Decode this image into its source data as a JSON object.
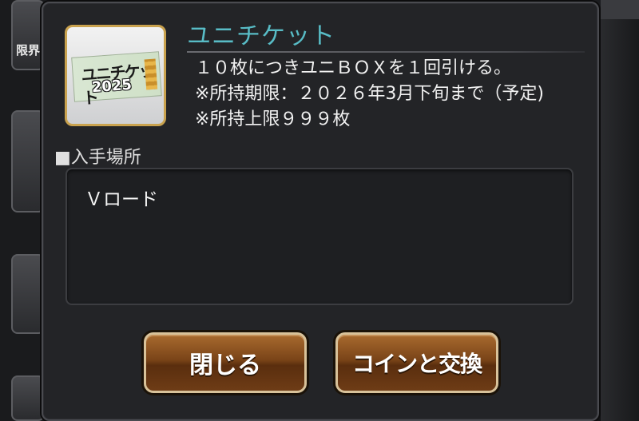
{
  "background": {
    "side_card_label": "限界"
  },
  "dialog": {
    "title": "ユニチケット",
    "item_image": {
      "ticket_text": "ユニチケット",
      "ticket_year": "2025"
    },
    "description": {
      "line1": "１０枚につきユニＢＯＸを１回引ける。",
      "line2": "※所持期限：２０２６年3月下旬まで（予定)",
      "line3": "※所持上限９９９枚"
    },
    "source_section": {
      "label": "■入手場所",
      "items": [
        "Ｖロード"
      ]
    },
    "buttons": {
      "close": "閉じる",
      "exchange": "コインと交換"
    }
  },
  "colors": {
    "title": "#58bcc6",
    "button_border": "#d8c29a",
    "thumb_border": "#c9a24e"
  }
}
